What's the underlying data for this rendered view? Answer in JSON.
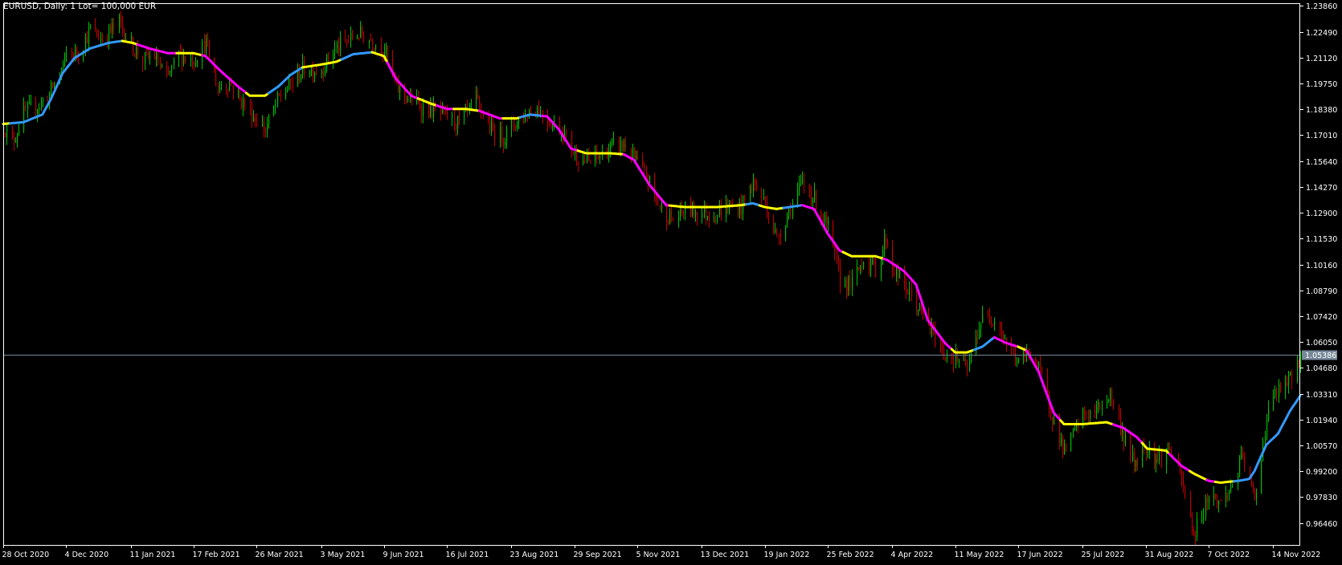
{
  "header": {
    "title": "EURUSD, Daily:  1 Lot= 100,000 EUR"
  },
  "colors": {
    "background": "#000000",
    "frame": "#ffffff",
    "bull_candle": "#00c000",
    "bear_candle": "#c00000",
    "ma_up": "#3399ff",
    "ma_down": "#ff00ff",
    "ma_flat": "#ffff00",
    "price_line": "#778899",
    "price_tag_bg": "#778899",
    "price_tag_text": "#ffffff",
    "axis_text": "#ffffff"
  },
  "current_price": {
    "label": "1.05386",
    "value": 1.05386
  },
  "chart_data": {
    "type": "candlestick",
    "title": "EURUSD, Daily:  1 Lot= 100,000 EUR",
    "xlabel": "",
    "ylabel": "",
    "ylim": [
      0.953,
      1.24
    ],
    "grid": false,
    "y_ticks": [
      {
        "value": 1.2386,
        "label": "1.23860"
      },
      {
        "value": 1.2249,
        "label": "1.22490"
      },
      {
        "value": 1.2112,
        "label": "1.21120"
      },
      {
        "value": 1.1975,
        "label": "1.19750"
      },
      {
        "value": 1.1838,
        "label": "1.18380"
      },
      {
        "value": 1.1701,
        "label": "1.17010"
      },
      {
        "value": 1.1564,
        "label": "1.15640"
      },
      {
        "value": 1.1427,
        "label": "1.14270"
      },
      {
        "value": 1.129,
        "label": "1.12900"
      },
      {
        "value": 1.1153,
        "label": "1.11530"
      },
      {
        "value": 1.1016,
        "label": "1.10160"
      },
      {
        "value": 1.0879,
        "label": "1.08790"
      },
      {
        "value": 1.0742,
        "label": "1.07420"
      },
      {
        "value": 1.0605,
        "label": "1.06050"
      },
      {
        "value": 1.0468,
        "label": "1.04680"
      },
      {
        "value": 1.0331,
        "label": "1.03310"
      },
      {
        "value": 1.0194,
        "label": "1.01940"
      },
      {
        "value": 1.0057,
        "label": "1.00570"
      },
      {
        "value": 0.992,
        "label": "0.99200"
      },
      {
        "value": 0.9783,
        "label": "0.97830"
      },
      {
        "value": 0.9646,
        "label": "0.96460"
      }
    ],
    "x_ticks": [
      {
        "date": "2020-10-28",
        "label": "28 Oct 2020"
      },
      {
        "date": "2020-12-04",
        "label": "4 Dec 2020"
      },
      {
        "date": "2021-01-11",
        "label": "11 Jan 2021"
      },
      {
        "date": "2021-02-17",
        "label": "17 Feb 2021"
      },
      {
        "date": "2021-03-26",
        "label": "26 Mar 2021"
      },
      {
        "date": "2021-05-03",
        "label": "3 May 2021"
      },
      {
        "date": "2021-06-09",
        "label": "9 Jun 2021"
      },
      {
        "date": "2021-07-16",
        "label": "16 Jul 2021"
      },
      {
        "date": "2021-08-23",
        "label": "23 Aug 2021"
      },
      {
        "date": "2021-09-29",
        "label": "29 Sep 2021"
      },
      {
        "date": "2021-11-05",
        "label": "5 Nov 2021"
      },
      {
        "date": "2021-12-13",
        "label": "13 Dec 2021"
      },
      {
        "date": "2022-01-19",
        "label": "19 Jan 2022"
      },
      {
        "date": "2022-02-25",
        "label": "25 Feb 2022"
      },
      {
        "date": "2022-04-04",
        "label": "4 Apr 2022"
      },
      {
        "date": "2022-05-11",
        "label": "11 May 2022"
      },
      {
        "date": "2022-06-17",
        "label": "17 Jun 2022"
      },
      {
        "date": "2022-07-25",
        "label": "25 Jul 2022"
      },
      {
        "date": "2022-08-31",
        "label": "31 Aug 2022"
      },
      {
        "date": "2022-10-07",
        "label": "7 Oct 2022"
      },
      {
        "date": "2022-11-14",
        "label": "14 Nov 2022"
      }
    ],
    "x_end_date": "2022-11-30",
    "close_path": [
      [
        "2020-10-28",
        1.175
      ],
      [
        "2020-11-02",
        1.166
      ],
      [
        "2020-11-09",
        1.182
      ],
      [
        "2020-11-16",
        1.185
      ],
      [
        "2020-11-23",
        1.19
      ],
      [
        "2020-12-01",
        1.205
      ],
      [
        "2020-12-04",
        1.212
      ],
      [
        "2020-12-11",
        1.214
      ],
      [
        "2020-12-18",
        1.226
      ],
      [
        "2020-12-25",
        1.221
      ],
      [
        "2021-01-04",
        1.23
      ],
      [
        "2021-01-11",
        1.218
      ],
      [
        "2021-01-18",
        1.21
      ],
      [
        "2021-01-25",
        1.212
      ],
      [
        "2021-02-01",
        1.199
      ],
      [
        "2021-02-08",
        1.213
      ],
      [
        "2021-02-17",
        1.21
      ],
      [
        "2021-02-24",
        1.219
      ],
      [
        "2021-03-03",
        1.195
      ],
      [
        "2021-03-10",
        1.198
      ],
      [
        "2021-03-17",
        1.188
      ],
      [
        "2021-03-26",
        1.178
      ],
      [
        "2021-03-31",
        1.173
      ],
      [
        "2021-04-08",
        1.19
      ],
      [
        "2021-04-15",
        1.197
      ],
      [
        "2021-04-22",
        1.205
      ],
      [
        "2021-05-03",
        1.205
      ],
      [
        "2021-05-10",
        1.215
      ],
      [
        "2021-05-18",
        1.22
      ],
      [
        "2021-05-25",
        1.224
      ],
      [
        "2021-06-02",
        1.22
      ],
      [
        "2021-06-09",
        1.216
      ],
      [
        "2021-06-16",
        1.195
      ],
      [
        "2021-06-23",
        1.19
      ],
      [
        "2021-07-01",
        1.185
      ],
      [
        "2021-07-08",
        1.183
      ],
      [
        "2021-07-16",
        1.18
      ],
      [
        "2021-07-23",
        1.176
      ],
      [
        "2021-08-02",
        1.188
      ],
      [
        "2021-08-11",
        1.173
      ],
      [
        "2021-08-19",
        1.169
      ],
      [
        "2021-08-23",
        1.175
      ],
      [
        "2021-08-30",
        1.18
      ],
      [
        "2021-09-06",
        1.185
      ],
      [
        "2021-09-14",
        1.178
      ],
      [
        "2021-09-22",
        1.172
      ],
      [
        "2021-09-29",
        1.16
      ],
      [
        "2021-10-06",
        1.156
      ],
      [
        "2021-10-14",
        1.159
      ],
      [
        "2021-10-21",
        1.164
      ],
      [
        "2021-10-28",
        1.165
      ],
      [
        "2021-11-05",
        1.155
      ],
      [
        "2021-11-12",
        1.145
      ],
      [
        "2021-11-19",
        1.13
      ],
      [
        "2021-11-26",
        1.125
      ],
      [
        "2021-12-03",
        1.131
      ],
      [
        "2021-12-13",
        1.129
      ],
      [
        "2021-12-20",
        1.128
      ],
      [
        "2021-12-28",
        1.132
      ],
      [
        "2022-01-05",
        1.132
      ],
      [
        "2022-01-12",
        1.145
      ],
      [
        "2022-01-19",
        1.134
      ],
      [
        "2022-01-26",
        1.115
      ],
      [
        "2022-02-02",
        1.13
      ],
      [
        "2022-02-10",
        1.145
      ],
      [
        "2022-02-17",
        1.136
      ],
      [
        "2022-02-25",
        1.12
      ],
      [
        "2022-03-04",
        1.093
      ],
      [
        "2022-03-11",
        1.091
      ],
      [
        "2022-03-18",
        1.105
      ],
      [
        "2022-03-25",
        1.099
      ],
      [
        "2022-03-31",
        1.116
      ],
      [
        "2022-04-04",
        1.1
      ],
      [
        "2022-04-11",
        1.09
      ],
      [
        "2022-04-18",
        1.08
      ],
      [
        "2022-04-25",
        1.07
      ],
      [
        "2022-05-03",
        1.055
      ],
      [
        "2022-05-11",
        1.052
      ],
      [
        "2022-05-18",
        1.046
      ],
      [
        "2022-05-26",
        1.072
      ],
      [
        "2022-06-03",
        1.074
      ],
      [
        "2022-06-10",
        1.06
      ],
      [
        "2022-06-17",
        1.049
      ],
      [
        "2022-06-24",
        1.056
      ],
      [
        "2022-07-01",
        1.041
      ],
      [
        "2022-07-08",
        1.018
      ],
      [
        "2022-07-14",
        1.002
      ],
      [
        "2022-07-25",
        1.022
      ],
      [
        "2022-08-01",
        1.023
      ],
      [
        "2022-08-10",
        1.033
      ],
      [
        "2022-08-18",
        1.01
      ],
      [
        "2022-08-24",
        0.996
      ],
      [
        "2022-08-31",
        1.006
      ],
      [
        "2022-09-07",
        0.998
      ],
      [
        "2022-09-14",
        1.004
      ],
      [
        "2022-09-21",
        0.987
      ],
      [
        "2022-09-28",
        0.958
      ],
      [
        "2022-10-07",
        0.98
      ],
      [
        "2022-10-14",
        0.975
      ],
      [
        "2022-10-21",
        0.985
      ],
      [
        "2022-10-27",
        1.0
      ],
      [
        "2022-11-03",
        0.976
      ],
      [
        "2022-11-10",
        1.02
      ],
      [
        "2022-11-14",
        1.032
      ],
      [
        "2022-11-18",
        1.035
      ],
      [
        "2022-11-23",
        1.039
      ],
      [
        "2022-11-30",
        1.0539
      ]
    ],
    "ma_path": [
      [
        "2020-10-28",
        1.176
      ],
      [
        "2020-11-09",
        1.177
      ],
      [
        "2020-11-20",
        1.181
      ],
      [
        "2020-11-25",
        1.189
      ],
      [
        "2020-12-02",
        1.203
      ],
      [
        "2020-12-09",
        1.211
      ],
      [
        "2020-12-18",
        1.216
      ],
      [
        "2020-12-29",
        1.219
      ],
      [
        "2021-01-06",
        1.22
      ],
      [
        "2021-01-12",
        1.219
      ],
      [
        "2021-01-22",
        1.216
      ],
      [
        "2021-02-02",
        1.2135
      ],
      [
        "2021-02-17",
        1.2135
      ],
      [
        "2021-02-24",
        1.212
      ],
      [
        "2021-03-05",
        1.204
      ],
      [
        "2021-03-15",
        1.196
      ],
      [
        "2021-03-22",
        1.191
      ],
      [
        "2021-03-31",
        1.191
      ],
      [
        "2021-04-08",
        1.196
      ],
      [
        "2021-04-15",
        1.202
      ],
      [
        "2021-04-22",
        1.206
      ],
      [
        "2021-05-03",
        1.2075
      ],
      [
        "2021-05-12",
        1.209
      ],
      [
        "2021-05-22",
        1.213
      ],
      [
        "2021-06-02",
        1.214
      ],
      [
        "2021-06-09",
        1.212
      ],
      [
        "2021-06-16",
        1.2
      ],
      [
        "2021-06-25",
        1.191
      ],
      [
        "2021-07-06",
        1.187
      ],
      [
        "2021-07-16",
        1.184
      ],
      [
        "2021-07-27",
        1.184
      ],
      [
        "2021-08-04",
        1.183
      ],
      [
        "2021-08-16",
        1.179
      ],
      [
        "2021-08-26",
        1.179
      ],
      [
        "2021-09-03",
        1.181
      ],
      [
        "2021-09-13",
        1.18
      ],
      [
        "2021-09-20",
        1.173
      ],
      [
        "2021-09-27",
        1.163
      ],
      [
        "2021-10-06",
        1.1605
      ],
      [
        "2021-10-20",
        1.1605
      ],
      [
        "2021-10-28",
        1.16
      ],
      [
        "2021-11-03",
        1.157
      ],
      [
        "2021-11-12",
        1.144
      ],
      [
        "2021-11-22",
        1.133
      ],
      [
        "2021-12-03",
        1.132
      ],
      [
        "2021-12-22",
        1.132
      ],
      [
        "2022-01-05",
        1.133
      ],
      [
        "2022-01-12",
        1.134
      ],
      [
        "2022-01-19",
        1.132
      ],
      [
        "2022-01-26",
        1.131
      ],
      [
        "2022-02-10",
        1.133
      ],
      [
        "2022-02-17",
        1.131
      ],
      [
        "2022-02-25",
        1.118
      ],
      [
        "2022-03-04",
        1.109
      ],
      [
        "2022-03-11",
        1.106
      ],
      [
        "2022-03-25",
        1.106
      ],
      [
        "2022-04-01",
        1.104
      ],
      [
        "2022-04-11",
        1.098
      ],
      [
        "2022-04-18",
        1.091
      ],
      [
        "2022-04-25",
        1.072
      ],
      [
        "2022-05-05",
        1.06
      ],
      [
        "2022-05-11",
        1.055
      ],
      [
        "2022-05-18",
        1.055
      ],
      [
        "2022-05-27",
        1.058
      ],
      [
        "2022-06-03",
        1.063
      ],
      [
        "2022-06-10",
        1.06
      ],
      [
        "2022-06-17",
        1.058
      ],
      [
        "2022-06-22",
        1.056
      ],
      [
        "2022-06-29",
        1.045
      ],
      [
        "2022-07-08",
        1.023
      ],
      [
        "2022-07-14",
        1.017
      ],
      [
        "2022-07-25",
        1.017
      ],
      [
        "2022-08-08",
        1.018
      ],
      [
        "2022-08-18",
        1.015
      ],
      [
        "2022-08-26",
        1.01
      ],
      [
        "2022-09-01",
        1.004
      ],
      [
        "2022-09-12",
        1.003
      ],
      [
        "2022-09-21",
        0.995
      ],
      [
        "2022-09-28",
        0.991
      ],
      [
        "2022-10-07",
        0.987
      ],
      [
        "2022-10-14",
        0.986
      ],
      [
        "2022-10-25",
        0.987
      ],
      [
        "2022-10-31",
        0.988
      ],
      [
        "2022-11-03",
        0.992
      ],
      [
        "2022-11-10",
        1.006
      ],
      [
        "2022-11-17",
        1.012
      ],
      [
        "2022-11-24",
        1.024
      ],
      [
        "2022-11-30",
        1.032
      ]
    ],
    "ma_segments": [
      {
        "start": "2020-10-28",
        "end": "2020-11-01",
        "trend": "flat"
      },
      {
        "start": "2020-11-01",
        "end": "2021-01-06",
        "trend": "up"
      },
      {
        "start": "2021-01-06",
        "end": "2021-01-15",
        "trend": "flat"
      },
      {
        "start": "2021-01-15",
        "end": "2021-02-07",
        "trend": "down"
      },
      {
        "start": "2021-02-07",
        "end": "2021-02-22",
        "trend": "flat"
      },
      {
        "start": "2021-02-22",
        "end": "2021-03-20",
        "trend": "down"
      },
      {
        "start": "2021-03-20",
        "end": "2021-04-02",
        "trend": "flat"
      },
      {
        "start": "2021-04-02",
        "end": "2021-04-22",
        "trend": "up"
      },
      {
        "start": "2021-04-22",
        "end": "2021-05-15",
        "trend": "flat"
      },
      {
        "start": "2021-05-15",
        "end": "2021-06-02",
        "trend": "up"
      },
      {
        "start": "2021-06-02",
        "end": "2021-06-11",
        "trend": "flat"
      },
      {
        "start": "2021-06-11",
        "end": "2021-06-29",
        "trend": "down"
      },
      {
        "start": "2021-06-29",
        "end": "2021-07-10",
        "trend": "flat"
      },
      {
        "start": "2021-07-10",
        "end": "2021-07-20",
        "trend": "down"
      },
      {
        "start": "2021-07-20",
        "end": "2021-08-04",
        "trend": "flat"
      },
      {
        "start": "2021-08-04",
        "end": "2021-08-18",
        "trend": "down"
      },
      {
        "start": "2021-08-18",
        "end": "2021-08-28",
        "trend": "flat"
      },
      {
        "start": "2021-08-28",
        "end": "2021-09-10",
        "trend": "up"
      },
      {
        "start": "2021-09-10",
        "end": "2021-10-01",
        "trend": "down"
      },
      {
        "start": "2021-10-01",
        "end": "2021-10-28",
        "trend": "flat"
      },
      {
        "start": "2021-10-28",
        "end": "2021-11-24",
        "trend": "down"
      },
      {
        "start": "2021-11-24",
        "end": "2022-01-08",
        "trend": "flat"
      },
      {
        "start": "2022-01-08",
        "end": "2022-01-16",
        "trend": "up"
      },
      {
        "start": "2022-01-16",
        "end": "2022-01-30",
        "trend": "flat"
      },
      {
        "start": "2022-01-30",
        "end": "2022-02-10",
        "trend": "up"
      },
      {
        "start": "2022-02-10",
        "end": "2022-03-06",
        "trend": "down"
      },
      {
        "start": "2022-03-06",
        "end": "2022-03-30",
        "trend": "flat"
      },
      {
        "start": "2022-03-30",
        "end": "2022-05-09",
        "trend": "down"
      },
      {
        "start": "2022-05-09",
        "end": "2022-05-22",
        "trend": "flat"
      },
      {
        "start": "2022-05-22",
        "end": "2022-06-03",
        "trend": "up"
      },
      {
        "start": "2022-06-03",
        "end": "2022-06-17",
        "trend": "down"
      },
      {
        "start": "2022-06-17",
        "end": "2022-06-22",
        "trend": "flat"
      },
      {
        "start": "2022-06-22",
        "end": "2022-07-12",
        "trend": "down"
      },
      {
        "start": "2022-07-12",
        "end": "2022-08-12",
        "trend": "flat"
      },
      {
        "start": "2022-08-12",
        "end": "2022-08-29",
        "trend": "down"
      },
      {
        "start": "2022-08-29",
        "end": "2022-09-14",
        "trend": "flat"
      },
      {
        "start": "2022-09-14",
        "end": "2022-09-26",
        "trend": "down"
      },
      {
        "start": "2022-09-26",
        "end": "2022-10-06",
        "trend": "flat"
      },
      {
        "start": "2022-10-06",
        "end": "2022-10-11",
        "trend": "down"
      },
      {
        "start": "2022-10-11",
        "end": "2022-10-22",
        "trend": "flat"
      },
      {
        "start": "2022-10-22",
        "end": "2022-11-30",
        "trend": "up"
      }
    ]
  }
}
